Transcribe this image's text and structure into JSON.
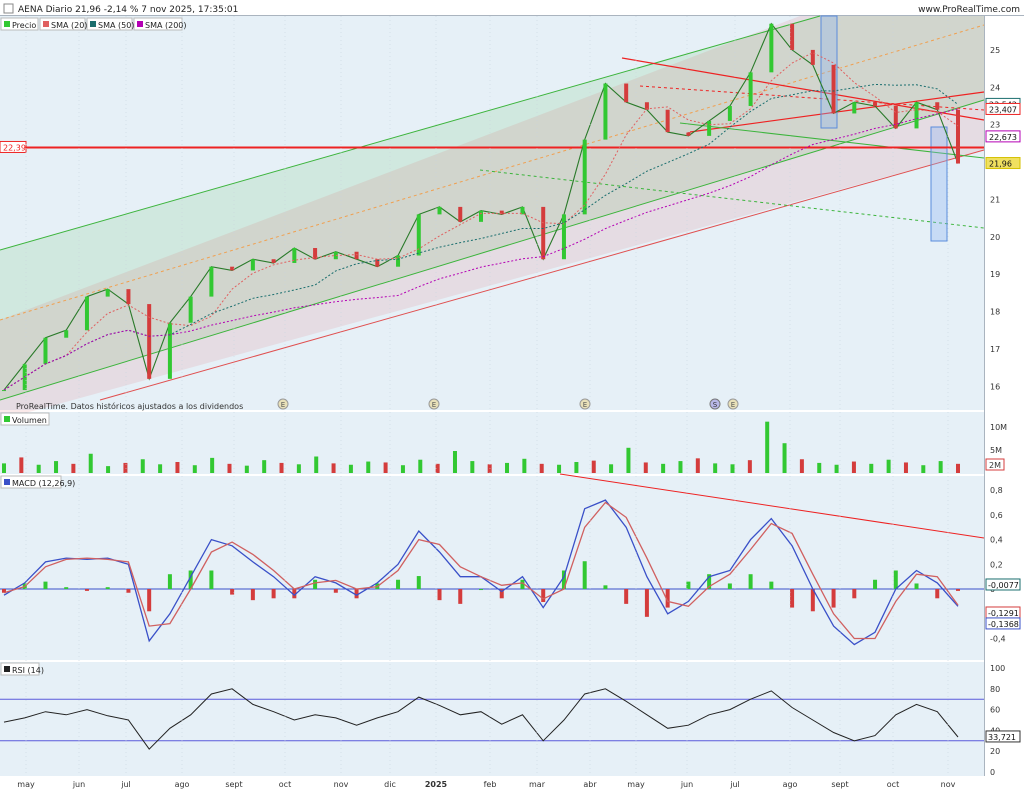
{
  "header": {
    "title": "AENA Diario 21,96 -2,14 % 7 nov 2025, 17:35:01",
    "brand": "www.ProRealTime.com"
  },
  "legend": {
    "price": "Precio",
    "sma20": "SMA (20)",
    "sma50": "SMA (50)",
    "sma200": "SMA (200)"
  },
  "footer_note": "ProRealTime. Datos históricos ajustados a los dividendos",
  "event_markers": [
    "E",
    "E",
    "E",
    "S",
    "E"
  ],
  "colors": {
    "up": "#32c832",
    "down": "#d43c3c",
    "sma20": "#e06060",
    "sma50": "#1a6e6e",
    "sma200": "#b400b4",
    "support": "#ee2222",
    "channel_green": "#3cb43c",
    "macd_line": "#3a50c8",
    "signal_line": "#d06060",
    "rsi_line": "#222222",
    "band": "#5a5adc"
  },
  "chart_data": [
    {
      "type": "line",
      "panel": "price",
      "title": "AENA Diario",
      "close": 21.96,
      "change_pct": -2.14,
      "x": [
        "may",
        "jun",
        "jul",
        "ago",
        "sept",
        "oct",
        "nov",
        "dic",
        "2025",
        "feb",
        "mar",
        "abr",
        "may",
        "jun",
        "jul",
        "ago",
        "sept",
        "oct",
        "nov"
      ],
      "y_ticks": [
        16,
        17,
        18,
        19,
        20,
        21,
        22,
        23,
        24,
        25
      ],
      "ylim": [
        15.5,
        25.8
      ],
      "series": [
        {
          "name": "Precio",
          "values": [
            15.9,
            16.6,
            17.3,
            17.5,
            18.4,
            18.6,
            18.2,
            16.2,
            17.7,
            18.4,
            19.2,
            19.1,
            19.4,
            19.3,
            19.7,
            19.4,
            19.6,
            19.4,
            19.2,
            19.5,
            20.6,
            20.8,
            20.4,
            20.7,
            20.6,
            20.8,
            19.4,
            20.6,
            22.6,
            24.1,
            23.6,
            23.4,
            22.8,
            22.7,
            23.1,
            23.5,
            24.4,
            25.7,
            25.0,
            24.6,
            23.3,
            23.6,
            23.5,
            22.9,
            23.6,
            23.4,
            21.96
          ]
        }
      ],
      "overlays": {
        "support_level": 22.39,
        "labels": [
          "23,542",
          "23,407",
          "22,673",
          "21,96",
          "22,39"
        ]
      }
    },
    {
      "type": "bar",
      "panel": "volume",
      "title": "Volumen",
      "y_ticks": [
        "10M",
        "5M"
      ],
      "last_value_label": "2M",
      "unit": "M",
      "values": [
        2.1,
        3.4,
        1.8,
        2.6,
        2.0,
        4.2,
        1.5,
        2.2,
        3.0,
        1.9,
        2.4,
        1.7,
        3.3,
        2.0,
        1.6,
        2.8,
        2.2,
        1.9,
        3.6,
        2.1,
        1.8,
        2.5,
        2.3,
        1.7,
        2.9,
        2.0,
        4.8,
        2.6,
        1.9,
        2.2,
        3.1,
        2.0,
        1.8,
        2.4,
        2.7,
        1.9,
        5.5,
        2.3,
        2.0,
        2.6,
        3.2,
        2.1,
        1.9,
        2.8,
        11.2,
        6.5,
        3.0,
        2.2,
        1.8,
        2.5,
        2.0,
        2.9,
        2.3,
        1.7,
        2.6,
        2.0
      ]
    },
    {
      "type": "line",
      "panel": "macd",
      "title": "MACD (12,26,9)",
      "y_ticks": [
        "0,8",
        "0,6",
        "0,4",
        "0,2",
        "0",
        "-0,2",
        "-0,4"
      ],
      "ylim": [
        -0.55,
        0.85
      ],
      "labels": [
        "-0,0077",
        "-0,1291",
        "-0,1368"
      ],
      "series": [
        {
          "name": "MACD",
          "values": [
            -0.05,
            0.05,
            0.22,
            0.25,
            0.24,
            0.25,
            0.2,
            -0.42,
            -0.2,
            0.1,
            0.4,
            0.35,
            0.22,
            0.1,
            -0.05,
            0.1,
            0.05,
            -0.05,
            0.05,
            0.2,
            0.47,
            0.3,
            0.1,
            0.1,
            -0.02,
            0.1,
            -0.15,
            0.1,
            0.65,
            0.72,
            0.5,
            0.1,
            -0.2,
            -0.1,
            0.1,
            0.15,
            0.4,
            0.57,
            0.35,
            0.0,
            -0.3,
            -0.45,
            -0.35,
            0.0,
            0.15,
            0.05,
            -0.14
          ]
        },
        {
          "name": "Señal",
          "values": [
            -0.03,
            0.02,
            0.18,
            0.24,
            0.25,
            0.24,
            0.22,
            -0.3,
            -0.28,
            0.0,
            0.3,
            0.38,
            0.28,
            0.15,
            0.0,
            0.05,
            0.07,
            0.0,
            0.02,
            0.15,
            0.4,
            0.36,
            0.18,
            0.1,
            0.03,
            0.05,
            -0.08,
            0.0,
            0.5,
            0.7,
            0.58,
            0.25,
            -0.1,
            -0.14,
            0.02,
            0.12,
            0.32,
            0.53,
            0.45,
            0.12,
            -0.2,
            -0.4,
            -0.4,
            -0.1,
            0.12,
            0.1,
            -0.13
          ]
        }
      ]
    },
    {
      "type": "line",
      "panel": "rsi",
      "title": "RSI (14)",
      "y_ticks": [
        "100",
        "80",
        "60",
        "40",
        "20",
        "0"
      ],
      "ylim": [
        0,
        100
      ],
      "bands": [
        70,
        30
      ],
      "last_value_label": "33,721",
      "series": [
        {
          "name": "RSI",
          "values": [
            48,
            52,
            58,
            55,
            60,
            54,
            50,
            22,
            42,
            55,
            75,
            80,
            65,
            58,
            50,
            55,
            52,
            45,
            52,
            58,
            72,
            64,
            55,
            58,
            46,
            55,
            30,
            50,
            75,
            80,
            68,
            55,
            42,
            45,
            55,
            60,
            70,
            78,
            62,
            50,
            38,
            30,
            35,
            55,
            65,
            58,
            33.7
          ]
        }
      ]
    }
  ]
}
